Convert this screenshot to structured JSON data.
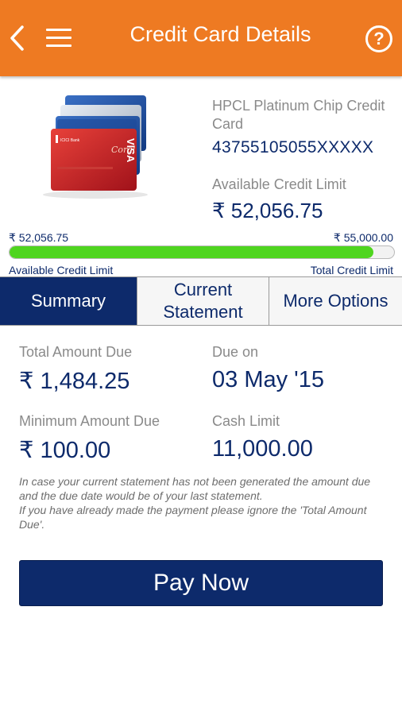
{
  "header": {
    "title": "Credit Card Details",
    "help_symbol": "?"
  },
  "card": {
    "name": "HPCL Platinum Chip Credit Card",
    "number": "43755105055XXXXX",
    "available_label": "Available Credit Limit",
    "available_value": "₹ 52,056.75"
  },
  "credit_bar": {
    "left_value": "₹ 52,056.75",
    "right_value": "₹ 55,000.00",
    "left_label": "Available Credit Limit",
    "right_label": "Total Credit Limit",
    "fill_fraction": 0.946,
    "fill_color": "#4fd51f"
  },
  "tabs": {
    "summary": "Summary",
    "statement_line1": "Current",
    "statement_line2": "Statement",
    "more": "More Options"
  },
  "summary": {
    "total_due_label": "Total Amount Due",
    "total_due_value": "₹ 1,484.25",
    "due_on_label": "Due on",
    "due_on_value": "03 May '15",
    "min_due_label": "Minimum Amount Due",
    "min_due_value": "₹ 100.00",
    "cash_limit_label": "Cash Limit",
    "cash_limit_value": "11,000.00",
    "note_line1": "In case your current statement has not been generated the amount due and the due date would be of your last statement.",
    "note_line2": "If you have already made the payment please ignore the 'Total Amount Due'."
  },
  "pay_button": "Pay Now",
  "colors": {
    "header": "#ee7a22",
    "primary": "#0d2a6b",
    "progress": "#4fd51f"
  }
}
